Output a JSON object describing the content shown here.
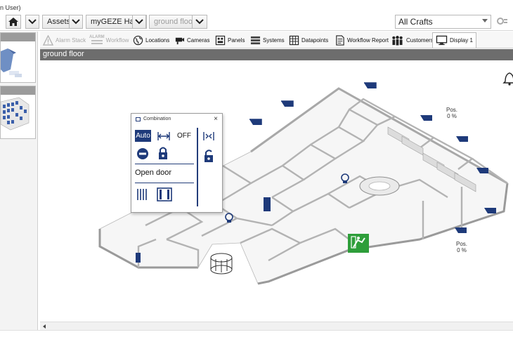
{
  "window": {
    "user_label": "n User)"
  },
  "nav": {
    "crumb1": "Assets",
    "crumb2": "myGEZE Haus",
    "crumb3": "ground floor",
    "crafts_value": "All Crafts"
  },
  "toolbar": {
    "alarm_stack": "Alarm Stack",
    "workflow": "Workflow",
    "alarm_badge": "ALARM",
    "locations": "Locations",
    "cameras": "Cameras",
    "panels": "Panels",
    "systems": "Systems",
    "datapoints": "Datapoints",
    "workflow_report": "Workflow Report",
    "customers": "Customers",
    "display": "Display 1"
  },
  "section": {
    "title": "ground floor"
  },
  "plan": {
    "pos_top": {
      "label": "Pos.",
      "value": "0 %"
    },
    "pos_bottom": {
      "label": "Pos.",
      "value": "0 %"
    }
  },
  "popup": {
    "title": "Combination",
    "auto": "Auto",
    "off": "OFF",
    "open_door": "Open door",
    "close": "×"
  },
  "colors": {
    "accent": "#1e3a7a",
    "exit_sign": "#2e9e3a",
    "section_bar": "#6d6d6d"
  }
}
